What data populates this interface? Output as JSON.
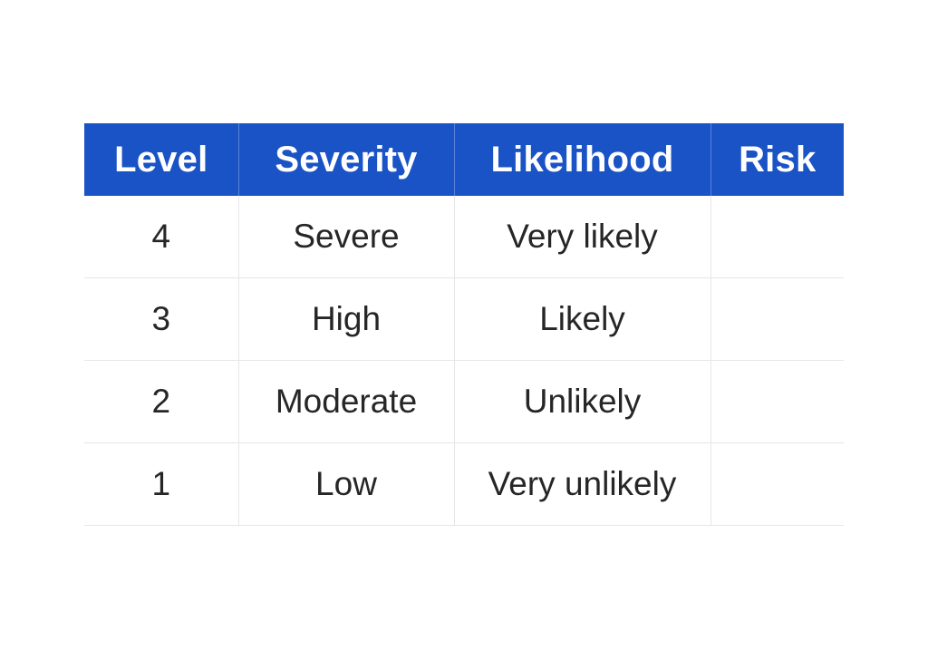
{
  "table": {
    "headers": [
      "Level",
      "Severity",
      "Likelihood",
      "Risk"
    ],
    "rows": [
      {
        "level": "4",
        "severity": "Severe",
        "likelihood": "Very likely",
        "risk": ""
      },
      {
        "level": "3",
        "severity": "High",
        "likelihood": "Likely",
        "risk": ""
      },
      {
        "level": "2",
        "severity": "Moderate",
        "likelihood": "Unlikely",
        "risk": ""
      },
      {
        "level": "1",
        "severity": "Low",
        "likelihood": "Very unlikely",
        "risk": ""
      }
    ]
  },
  "colors": {
    "header_background": "#1a53c6",
    "header_text": "#ffffff",
    "body_text": "#262626",
    "grid_lines": "#e6e6e6"
  }
}
